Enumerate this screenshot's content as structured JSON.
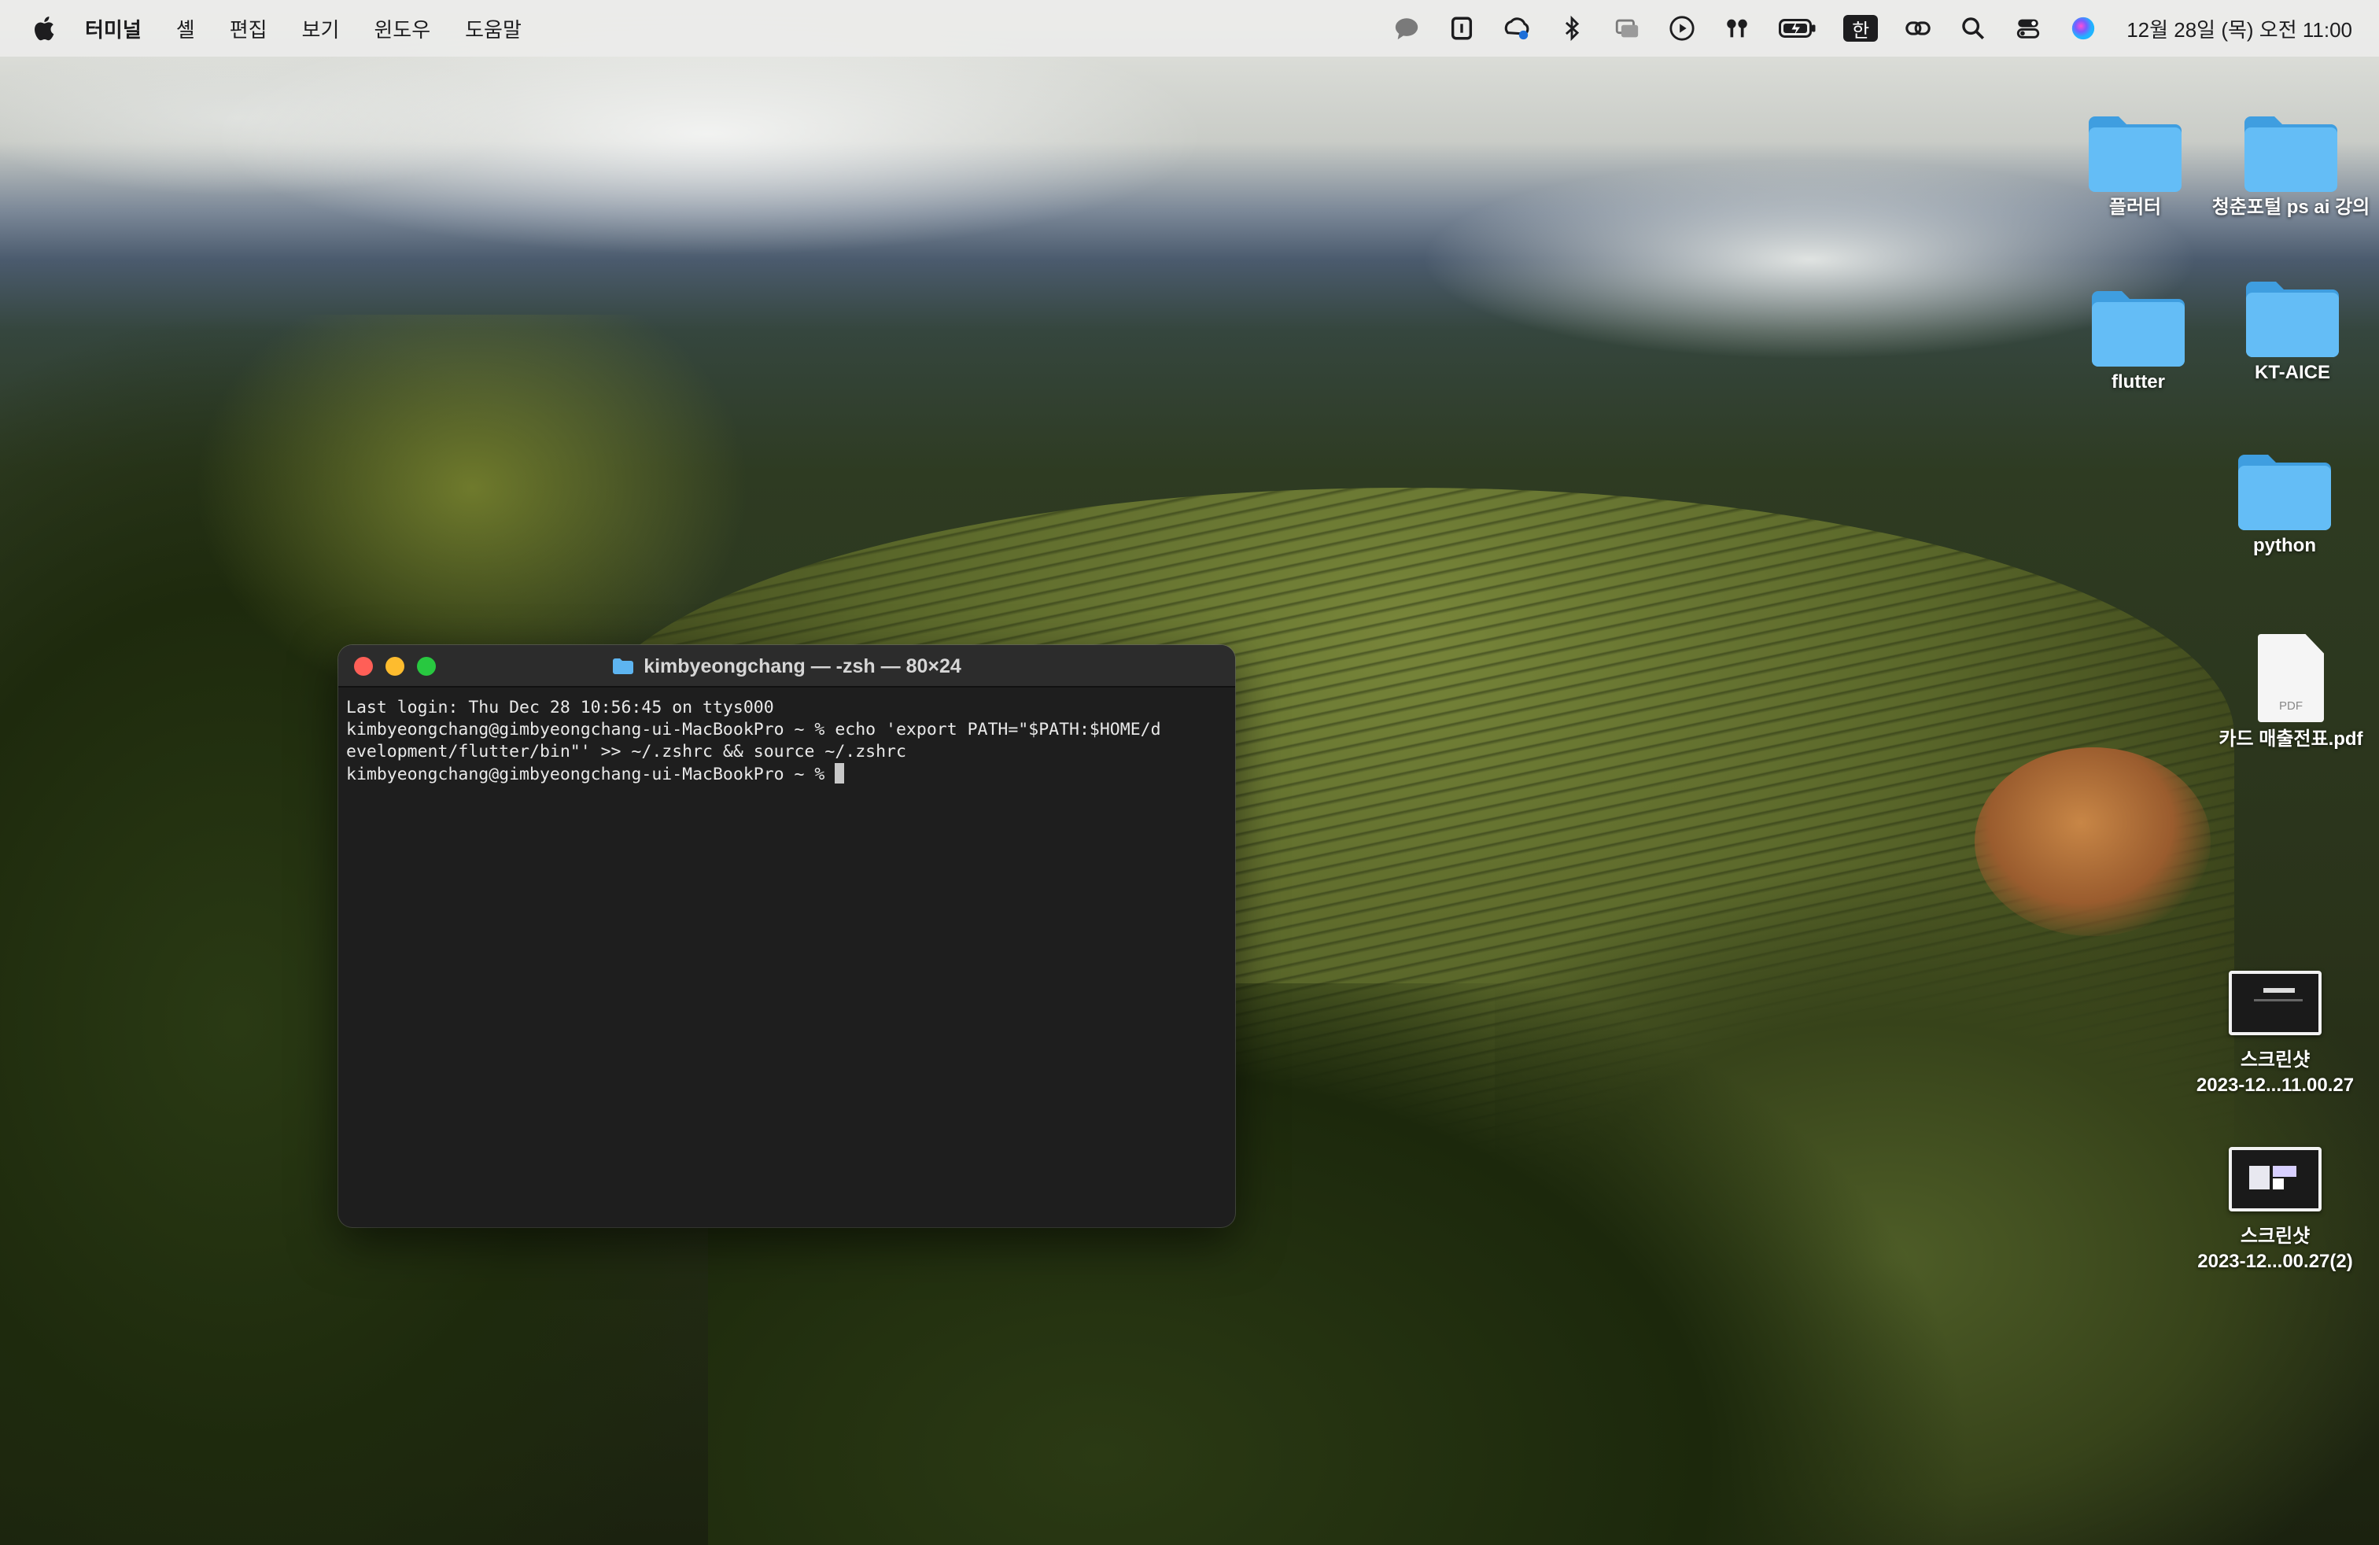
{
  "menubar": {
    "app_name": "터미널",
    "items": [
      "셸",
      "편집",
      "보기",
      "윈도우",
      "도움말"
    ],
    "input_source": "한",
    "clock": "12월 28일 (목) 오전 11:00",
    "status_icons": [
      "chat-bubble-icon",
      "notes-icon",
      "creative-cloud-icon",
      "bluetooth-icon",
      "screen-mirror-icon",
      "play-icon",
      "airpods-icon",
      "battery-icon",
      "input-source-icon",
      "link-icon",
      "search-icon",
      "control-center-icon",
      "siri-icon"
    ]
  },
  "terminal": {
    "title": "kimbyeongchang — -zsh — 80×24",
    "lines": [
      "Last login: Thu Dec 28 10:56:45 on ttys000",
      "kimbyeongchang@gimbyeongchang-ui-MacBookPro ~ % echo 'export PATH=\"$PATH:$HOME/d",
      "evelopment/flutter/bin\"' >> ~/.zshrc && source ~/.zshrc",
      "kimbyeongchang@gimbyeongchang-ui-MacBookPro ~ % "
    ]
  },
  "desktop": {
    "icons": [
      {
        "label": "플러터",
        "kind": "folder"
      },
      {
        "label": "청춘포털 ps ai 강의",
        "kind": "folder"
      },
      {
        "label": "flutter",
        "kind": "folder"
      },
      {
        "label": "KT-AICE",
        "kind": "folder"
      },
      {
        "label": "python",
        "kind": "folder"
      },
      {
        "label": "카드 매출전표.pdf",
        "kind": "pdf",
        "tag": "PDF"
      },
      {
        "label_line1": "스크린샷",
        "label_line2": "2023-12...11.00.27",
        "kind": "screenshot"
      },
      {
        "label_line1": "스크린샷",
        "label_line2": "2023-12...00.27(2)",
        "kind": "screenshot"
      }
    ]
  },
  "colors": {
    "folder": "#5db4f0",
    "terminal_bg": "#1e1e1e",
    "close": "#ff5f57",
    "minimize": "#febc2e",
    "maximize": "#28c840"
  }
}
